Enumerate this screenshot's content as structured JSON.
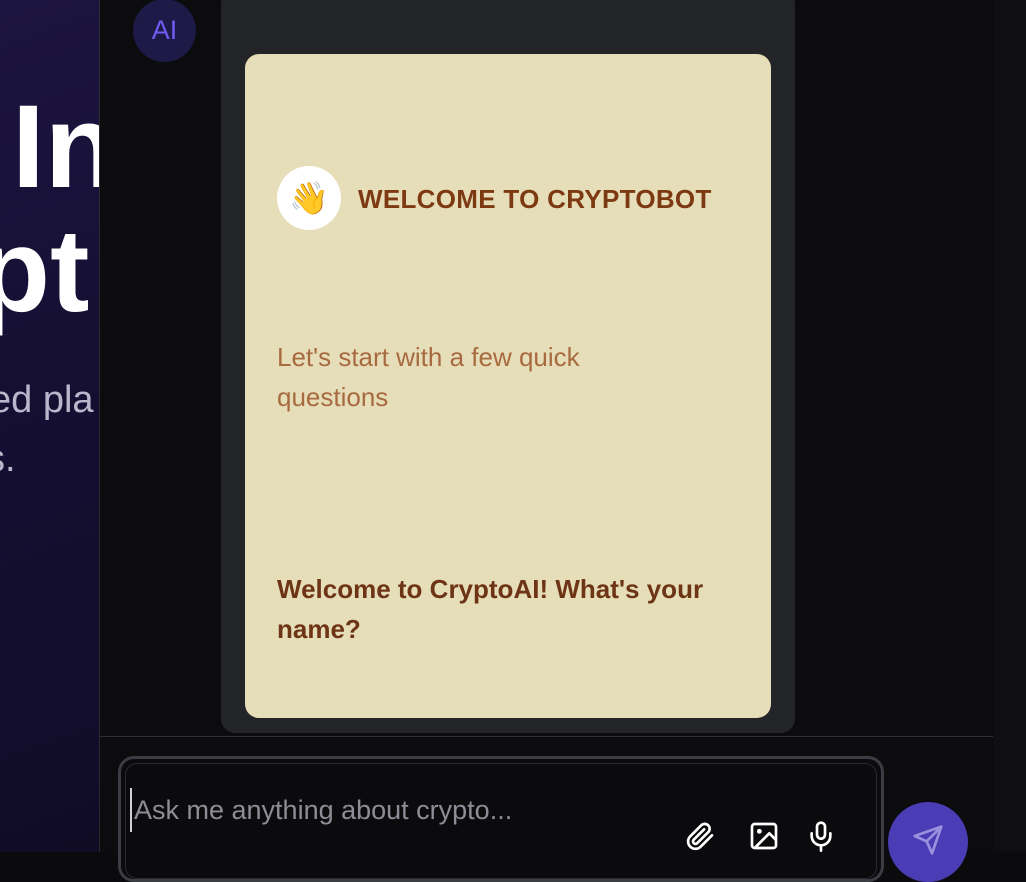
{
  "hero": {
    "line1": "In",
    "line2": "pt",
    "sub1": "ed pla",
    "sub2": "s."
  },
  "chat": {
    "avatar_label": "AI",
    "card": {
      "emoji": "👋",
      "title": "WELCOME TO CRYPTOBOT",
      "subtitle": "Let's start with a few quick questions",
      "question": "Welcome to CryptoAI! What's your name?"
    },
    "input": {
      "placeholder": "Ask me anything about crypto...",
      "value": ""
    },
    "icons": {
      "attach": "paperclip-icon",
      "image": "image-icon",
      "mic": "microphone-icon",
      "send": "send-icon"
    }
  },
  "colors": {
    "accent": "#4a3cb4",
    "card_bg": "#e6ddb9",
    "card_title": "#7d3a12"
  }
}
